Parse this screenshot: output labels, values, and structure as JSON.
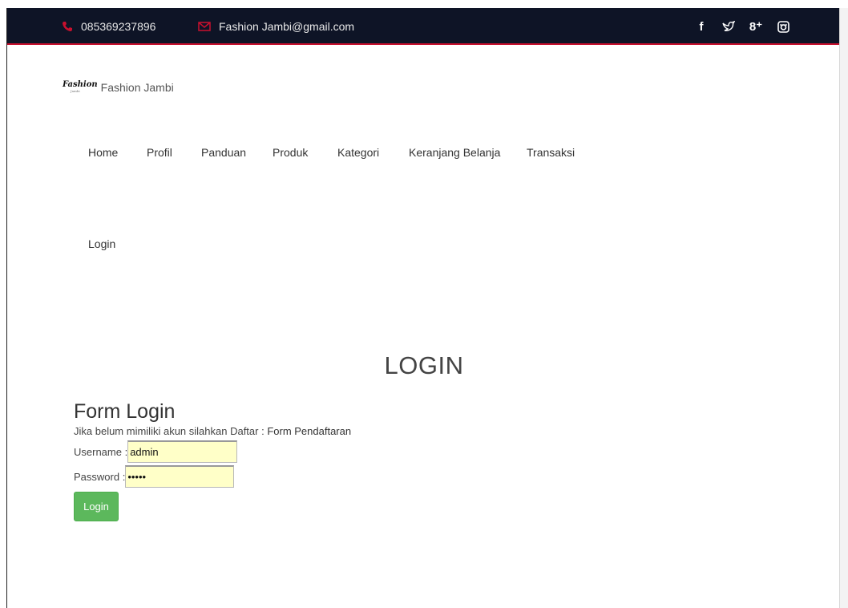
{
  "topbar": {
    "phone": "085369237896",
    "email": "Fashion Jambi@gmail.com",
    "social": [
      {
        "icon": "facebook-icon",
        "glyph": "f"
      },
      {
        "icon": "twitter-icon",
        "glyph": "ᵯ"
      },
      {
        "icon": "google-plus-icon",
        "glyph": "8⁺"
      },
      {
        "icon": "instagram-icon",
        "glyph": ""
      }
    ],
    "accent": "#c8102e",
    "background": "#0e1426"
  },
  "brand": {
    "logo_text": "Fashion",
    "logo_sub": "Jambi",
    "name": "Fashion Jambi"
  },
  "nav": {
    "items": [
      "Home",
      "Profil",
      "Panduan",
      "Produk",
      "Kategori",
      "Keranjang Belanja",
      "Transaksi"
    ],
    "login": "Login"
  },
  "page": {
    "heading": "LOGIN"
  },
  "form": {
    "title": "Form Login",
    "hint_prefix": "Jika belum mimiliki akun silahkan Daftar : ",
    "hint_link": "Form Pendaftaran",
    "username_label": "Username : ",
    "username_value": "admin",
    "password_label": "Password : ",
    "password_value": "admin",
    "submit_label": "Login",
    "button_color": "#5cb85c",
    "input_background": "#ffffc8"
  }
}
